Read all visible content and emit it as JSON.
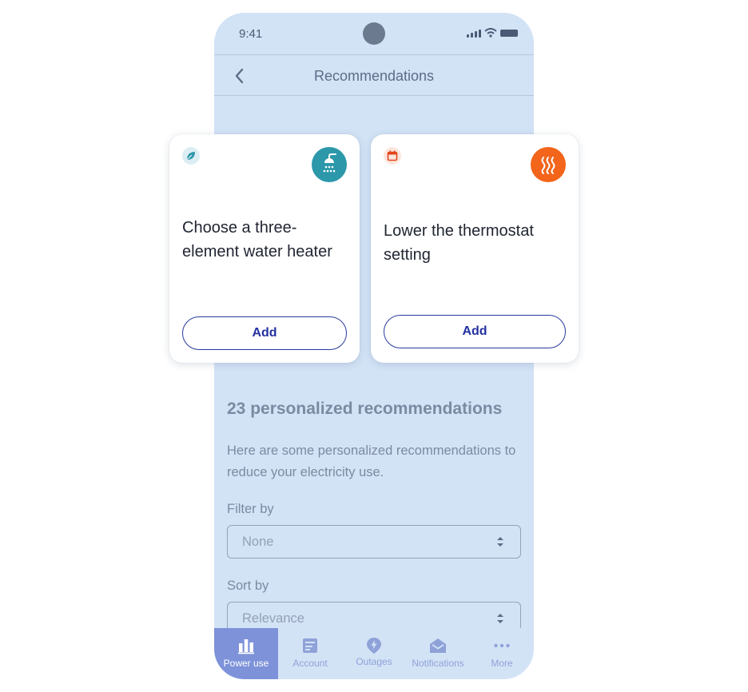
{
  "status_bar": {
    "time": "9:41"
  },
  "header": {
    "title": "Recommendations",
    "back_icon": "chevron-left-icon"
  },
  "cards": [
    {
      "badge_icon": "leaf-icon",
      "icon": "shower-icon",
      "icon_color": "#2c98aa",
      "title": "Choose a three-element water heater",
      "button_label": "Add"
    },
    {
      "badge_icon": "calendar-icon",
      "icon": "heat-icon",
      "icon_color": "#f2651b",
      "title": "Lower the thermostat setting",
      "button_label": "Add"
    }
  ],
  "section": {
    "title": "23 personalized recommendations",
    "description": "Here are some personalized recommendations to reduce your electricity use."
  },
  "filter": {
    "label": "Filter by",
    "value": "None"
  },
  "sort": {
    "label": "Sort by",
    "value": "Relevance"
  },
  "tabs": [
    {
      "label": "Power use",
      "icon": "bar-chart-icon",
      "active": true
    },
    {
      "label": "Account",
      "icon": "account-icon",
      "active": false
    },
    {
      "label": "Outages",
      "icon": "lightning-icon",
      "active": false
    },
    {
      "label": "Notifications",
      "icon": "envelope-icon",
      "active": false
    },
    {
      "label": "More",
      "icon": "more-icon",
      "active": false
    }
  ],
  "colors": {
    "phone_background": "#d3e3f6",
    "accent": "#2230a0",
    "active_tab": "#7d92d9"
  }
}
